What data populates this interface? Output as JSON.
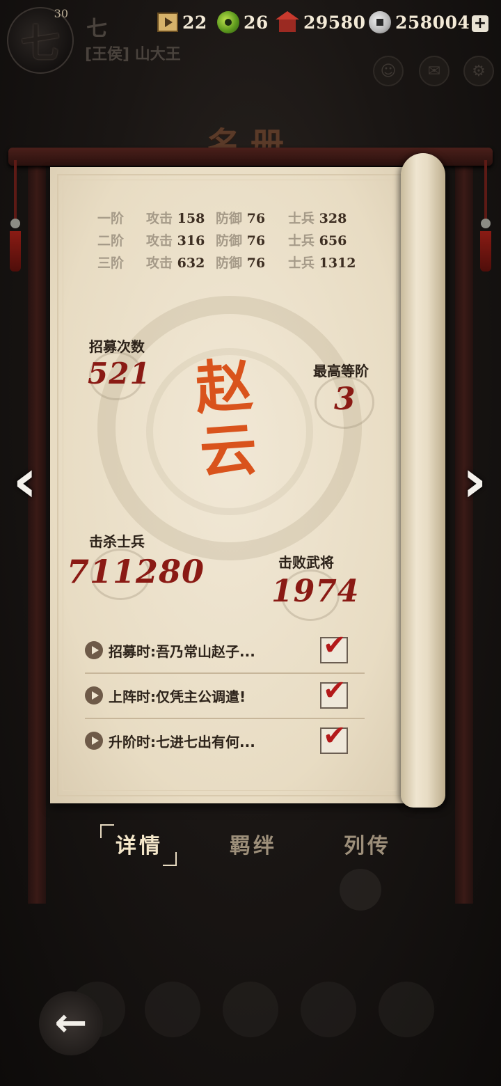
{
  "player": {
    "avatar_char": "七",
    "level": "30",
    "name": "七",
    "title": "[王侯] 山大王"
  },
  "resources": [
    {
      "icon": "scroll-ticket-icon",
      "value": "22"
    },
    {
      "icon": "jade-icon",
      "value": "26"
    },
    {
      "icon": "house-food-icon",
      "value": "29580"
    },
    {
      "icon": "silver-coin-icon",
      "value": "258004"
    }
  ],
  "page_title": "名册",
  "tiers": [
    {
      "name": "一阶",
      "atk_label": "攻击",
      "atk": "158",
      "def_label": "防御",
      "def": "76",
      "sol_label": "士兵",
      "sol": "328"
    },
    {
      "name": "二阶",
      "atk_label": "攻击",
      "atk": "316",
      "def_label": "防御",
      "def": "76",
      "sol_label": "士兵",
      "sol": "656"
    },
    {
      "name": "三阶",
      "atk_label": "攻击",
      "atk": "632",
      "def_label": "防御",
      "def": "76",
      "sol_label": "士兵",
      "sol": "1312"
    }
  ],
  "hero": {
    "name_line1": "赵",
    "name_line2": "云"
  },
  "stats": {
    "recruit_label": "招募次数",
    "recruit_value": "521",
    "max_tier_label": "最高等阶",
    "max_tier_value": "3",
    "kills_label": "击杀士兵",
    "kills_value": "711280",
    "defeats_label": "击败武将",
    "defeats_value": "1974"
  },
  "voice_lines": [
    {
      "text": "招募时:吾乃常山赵子...",
      "checked": true
    },
    {
      "text": "上阵时:仅凭主公调遣!",
      "checked": true
    },
    {
      "text": "升阶时:七进七出有何...",
      "checked": true
    }
  ],
  "tabs": [
    {
      "label": "详情",
      "active": true
    },
    {
      "label": "羁绊",
      "active": false
    },
    {
      "label": "列传",
      "active": false
    }
  ],
  "checkmark_glyph": "✔",
  "colors": {
    "hero_name": "#d9531c",
    "stat_number": "#8a1a14",
    "paper": "#ede3cf"
  }
}
